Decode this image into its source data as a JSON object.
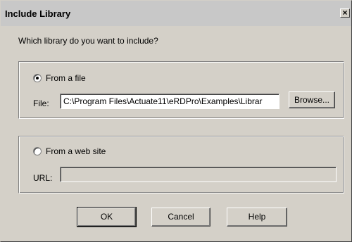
{
  "window": {
    "title": "Include Library",
    "close_glyph": "×"
  },
  "prompt": "Which library do you want to include?",
  "file_option": {
    "label": "From a file",
    "selected": true,
    "field_label": "File:",
    "value": "C:\\Program Files\\Actuate11\\eRDPro\\Examples\\Librar",
    "browse_label": "Browse..."
  },
  "web_option": {
    "label": "From a web site",
    "selected": false,
    "field_label": "URL:",
    "value": ""
  },
  "buttons": {
    "ok": "OK",
    "cancel": "Cancel",
    "help": "Help"
  }
}
